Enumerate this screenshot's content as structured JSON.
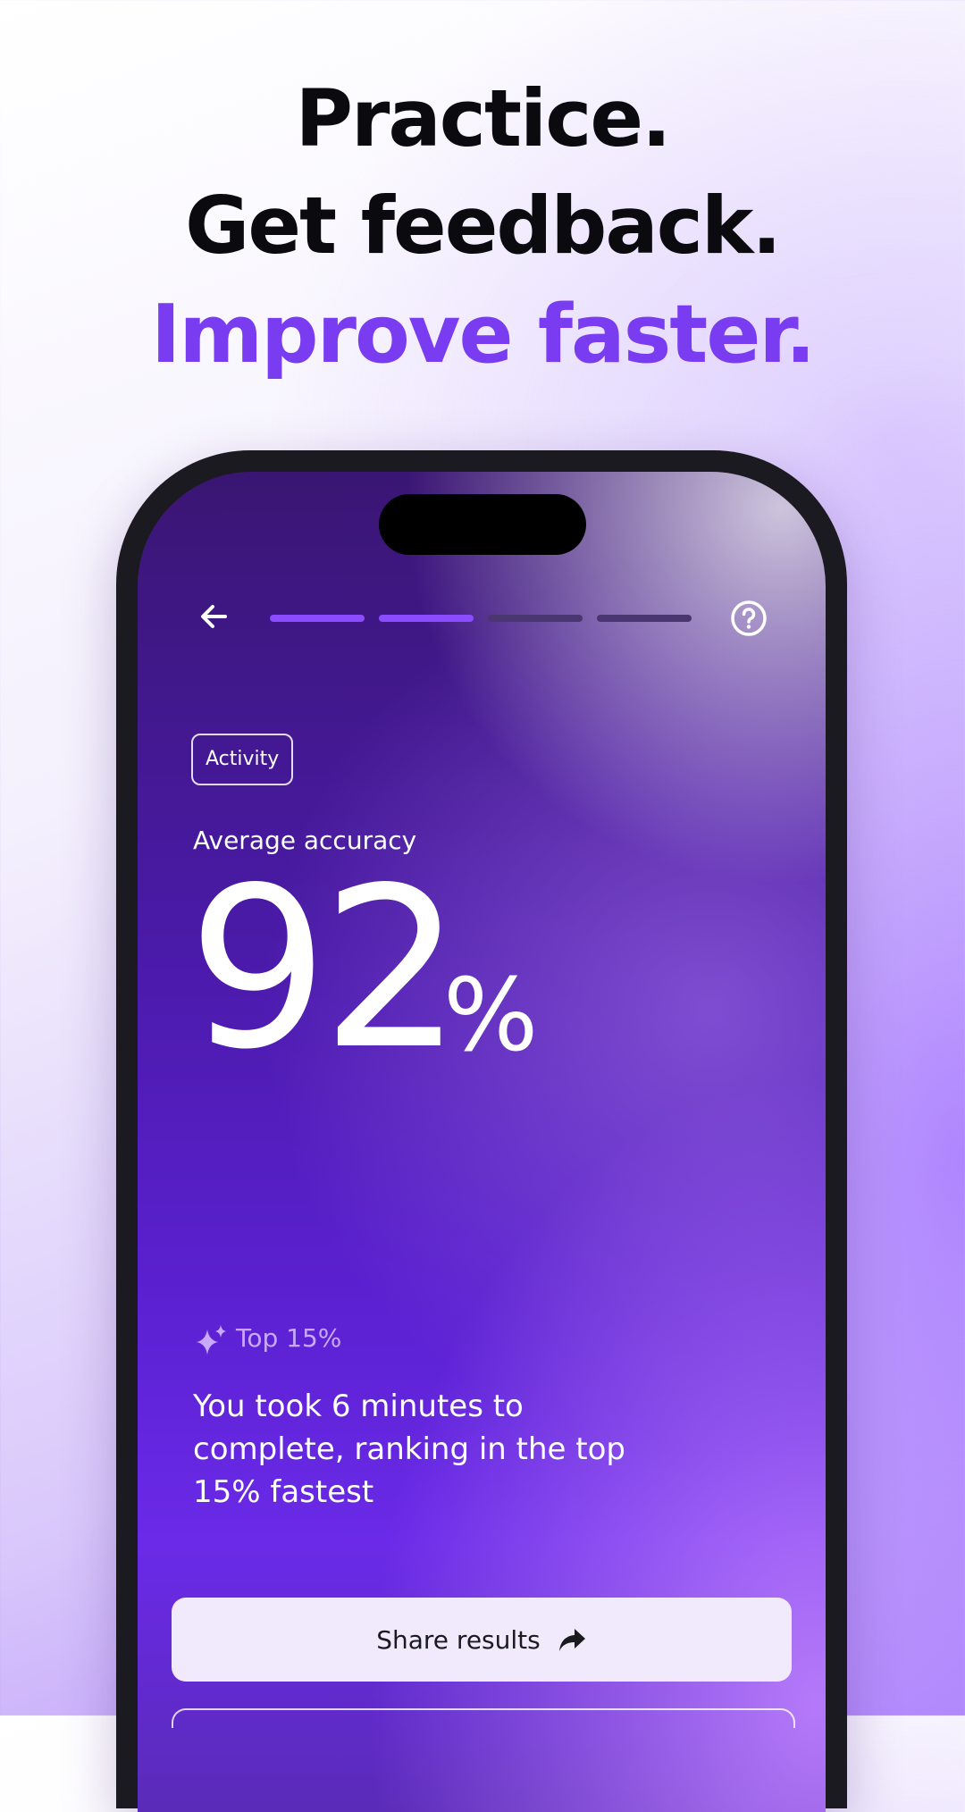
{
  "hero": {
    "line1": "Practice.",
    "line2": "Get feedback.",
    "line3": "Improve faster."
  },
  "colors": {
    "accent": "#7a3cf0",
    "progress_active": "#8b4cff",
    "progress_inactive": "#4a3670"
  },
  "app": {
    "progress": {
      "total_steps": 4,
      "completed_steps": 2
    },
    "icons": {
      "back": "arrow-left-icon",
      "help": "question-circle-icon",
      "sparkle": "sparkles-icon",
      "share": "share-arrow-icon"
    },
    "chip_label": "Activity",
    "metric_label": "Average accuracy",
    "metric_value": "92",
    "metric_unit": "%",
    "rank_label": "Top 15%",
    "description": "You took 6 minutes to complete, ranking in the top 15% fastest",
    "share_button_label": "Share results"
  }
}
